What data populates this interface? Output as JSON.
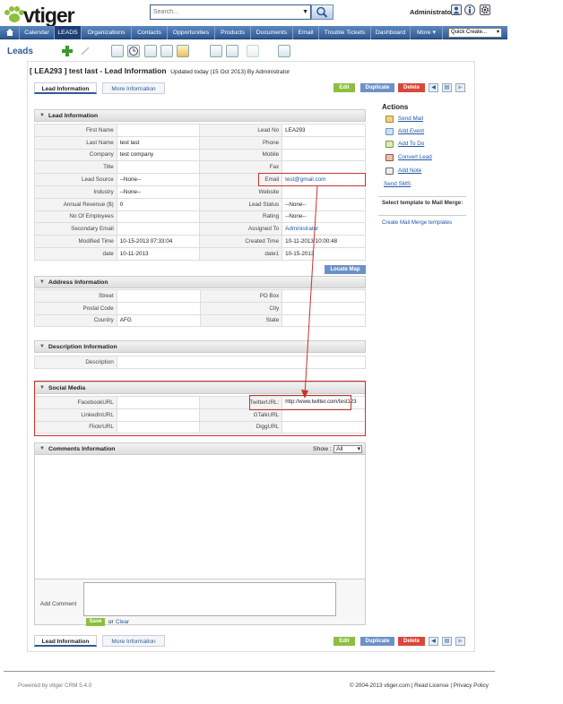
{
  "header": {
    "logo_text": "vtiger",
    "search_placeholder": "Search...",
    "user": "Administrator"
  },
  "nav": {
    "items": [
      "Calendar",
      "LEADS",
      "Organizations",
      "Contacts",
      "Opportunities",
      "Products",
      "Documents",
      "Email",
      "Trouble Tickets",
      "Dashboard",
      "More ▾"
    ],
    "quick_create": "Quick Create..."
  },
  "module_title": "Leads",
  "record": {
    "title": "[ LEA293 ] test last - Lead Information",
    "updated": "Updated today (15 Oct 2013) By Administrator"
  },
  "tabs": [
    "Lead Information",
    "More Information"
  ],
  "buttons": {
    "edit": "Edit",
    "duplicate": "Duplicate",
    "delete": "Delete",
    "locate_map": "Locate Map",
    "save": "Save",
    "or": "or",
    "clear": "Clear"
  },
  "sections": {
    "lead": "Lead Information",
    "address": "Address Information",
    "description": "Description Information",
    "social": "Social Media",
    "comments": "Comments Information"
  },
  "lead_rows": [
    [
      "First Name",
      "",
      "Lead No",
      "LEA293"
    ],
    [
      "Last Name",
      "test last",
      "Phone",
      ""
    ],
    [
      "Company",
      "test company",
      "Mobile",
      ""
    ],
    [
      "Title",
      "",
      "Fax",
      ""
    ],
    [
      "Lead Source",
      "--None--",
      "Email",
      "test@gmail.com"
    ],
    [
      "Industry",
      "--None--",
      "Website",
      ""
    ],
    [
      "Annual Revenue ($)",
      "0",
      "Lead Status",
      "--None--"
    ],
    [
      "No Of Employees",
      "",
      "Rating",
      "--None--"
    ],
    [
      "Secondary Email",
      "",
      "Assigned To",
      "Administrator"
    ],
    [
      "Modified Time",
      "10-15-2013 07:33:04",
      "Created Time",
      "10-11-2013 10:00:48"
    ],
    [
      "date",
      "10-11-2013",
      "date1",
      "10-15-2013"
    ]
  ],
  "address_rows": [
    [
      "Street",
      "",
      "PO Box",
      ""
    ],
    [
      "Postal Code",
      "",
      "City",
      ""
    ],
    [
      "Country",
      "AFG",
      "State",
      ""
    ]
  ],
  "description_rows": [
    [
      "Description",
      ""
    ]
  ],
  "social_rows": [
    [
      "FacebookURL",
      "",
      "TwitterURL:",
      "http://www.twitter.com/test123"
    ],
    [
      "LinkedInURL",
      "",
      "GTalkURL",
      ""
    ],
    [
      "FlickrURL",
      "",
      "DiggURL",
      ""
    ]
  ],
  "comments": {
    "show_label": "Show :",
    "show_value": "All",
    "add_comment": "Add Comment"
  },
  "actions": {
    "title": "Actions",
    "items": [
      "Send Mail",
      "Add Event",
      "Add To Do",
      "Convert Lead",
      "Add Note"
    ],
    "send_sms": "Send SMS",
    "mail_merge_title": "Select template to Mail Merge:",
    "mail_merge_link": "Create Mail Merge templates"
  },
  "footer": {
    "left": "Powered by vtiger CRM 5.4.0",
    "right": "© 2004-2013 vtiger.com | Read License | Privacy Policy"
  }
}
